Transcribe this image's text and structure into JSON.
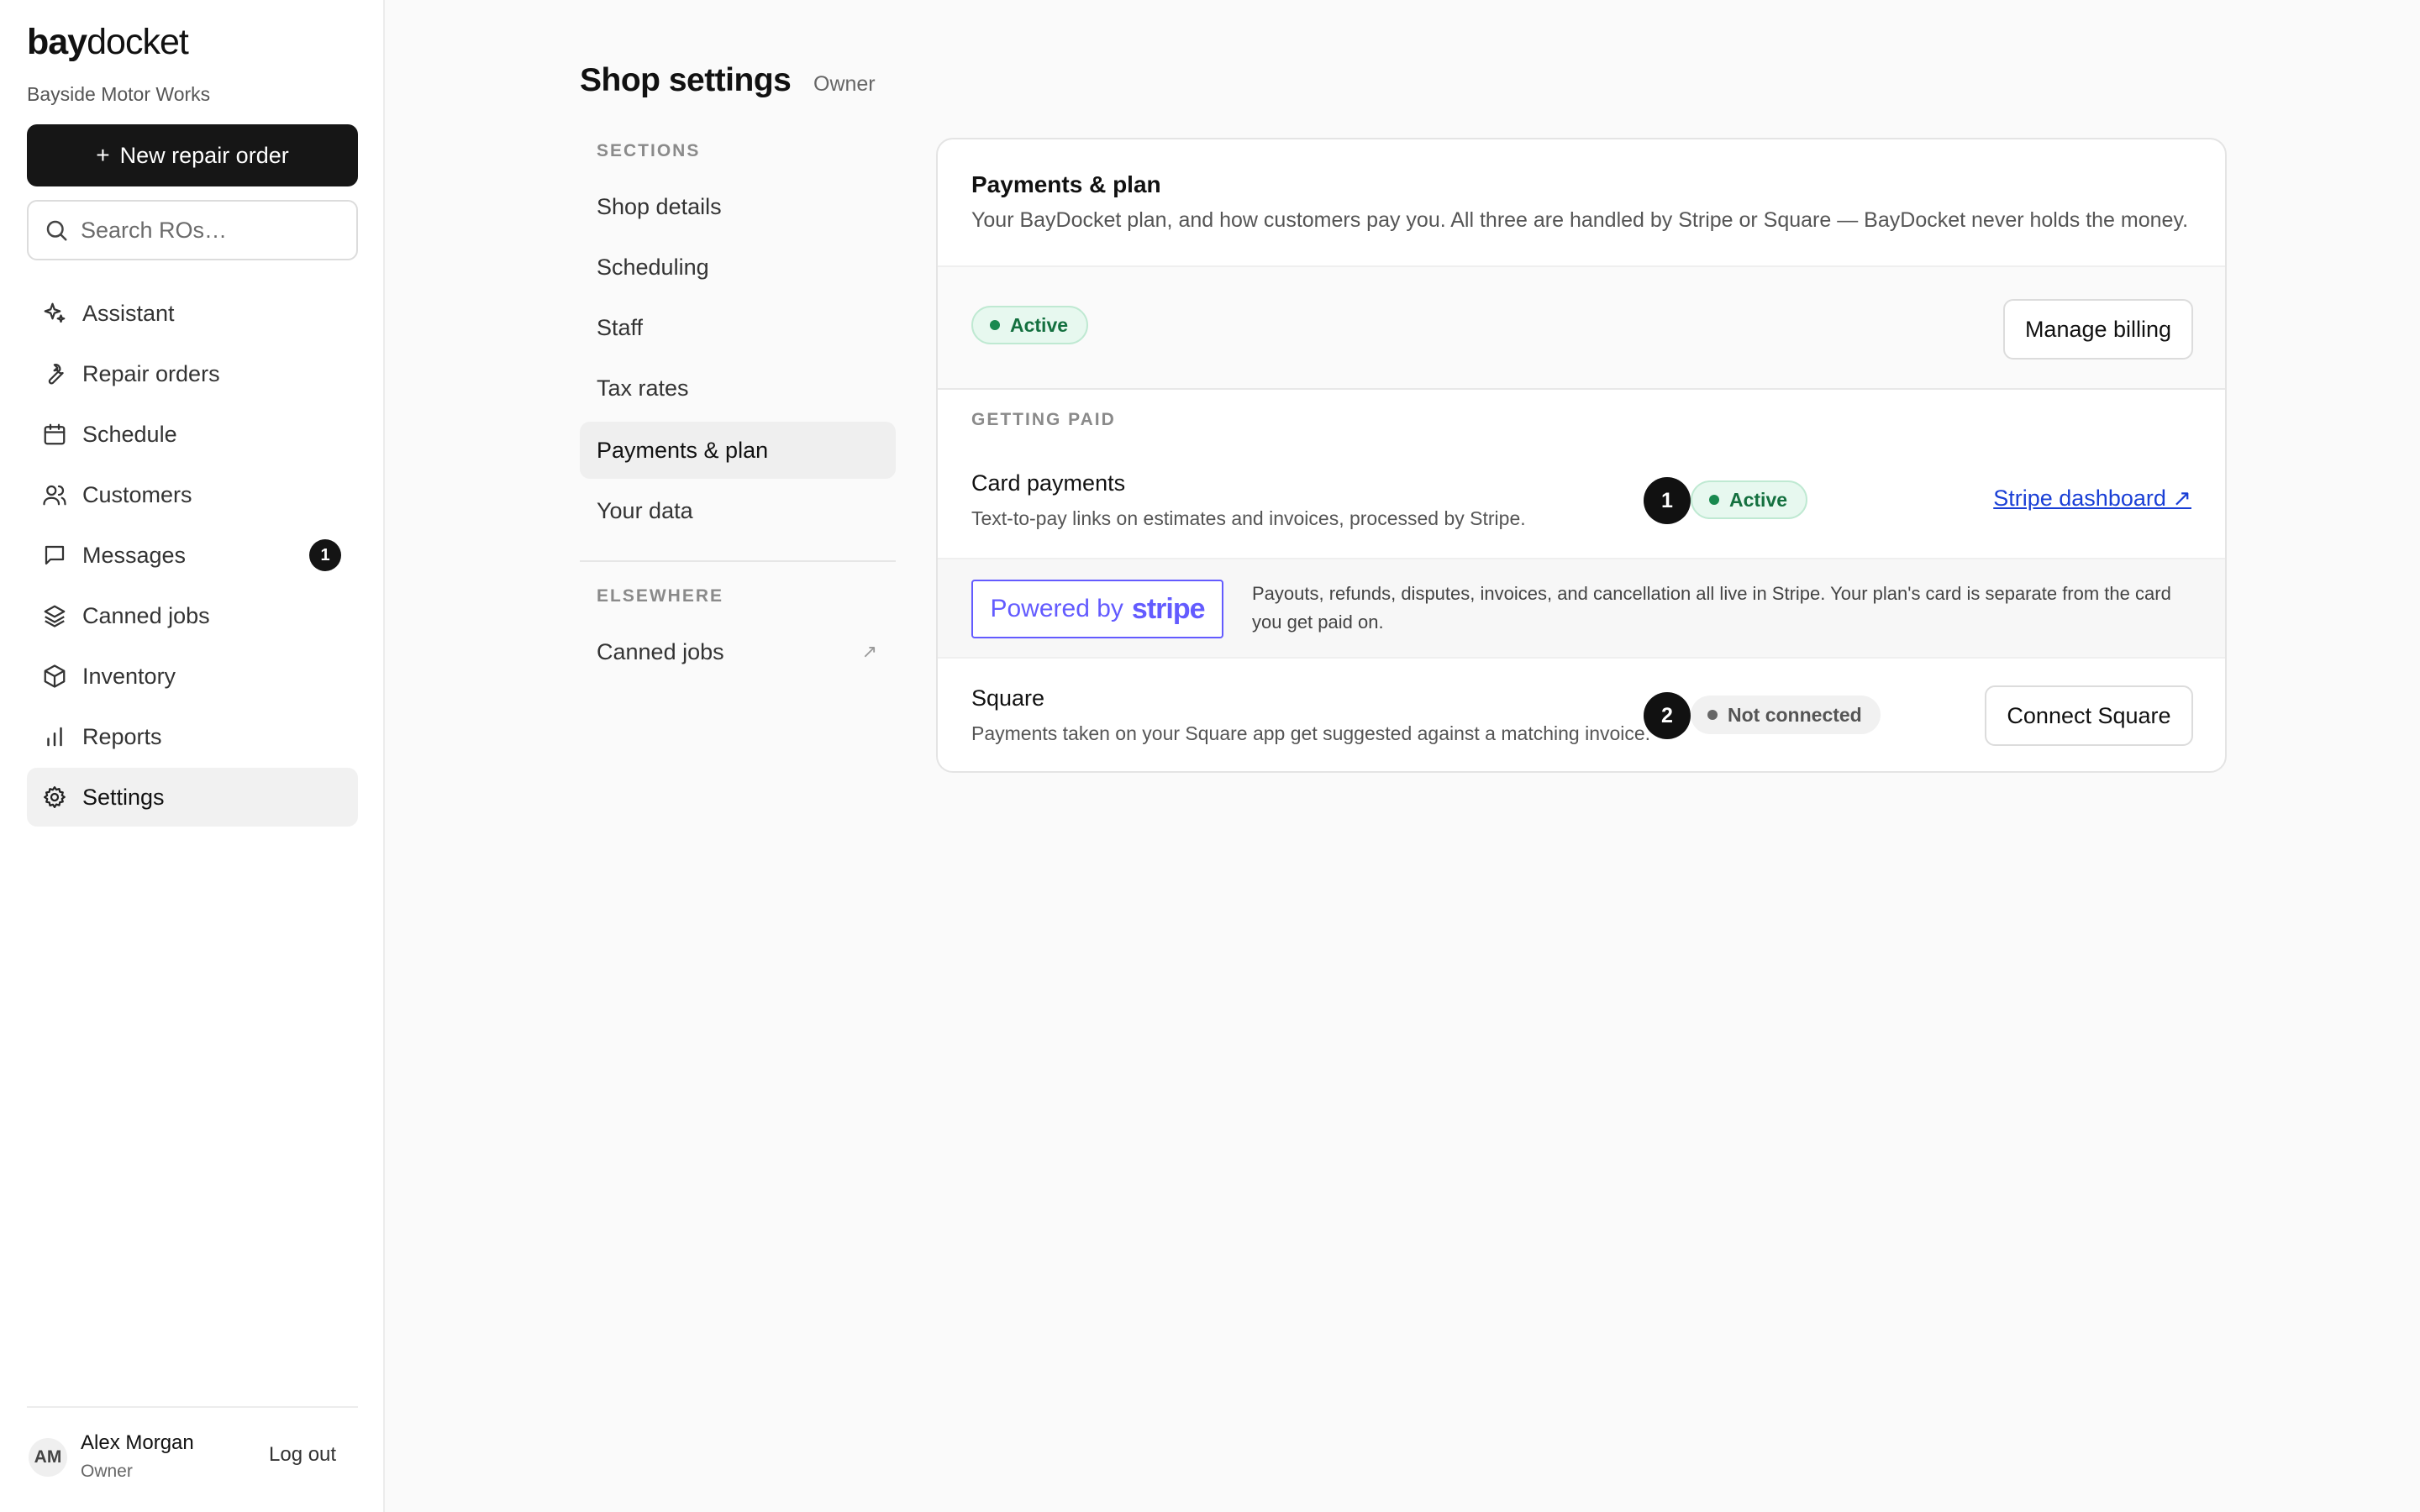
{
  "brand": {
    "logo_bold": "bay",
    "logo_light": "docket",
    "shop_name": "Bayside Motor Works"
  },
  "sidebar": {
    "new_ro_label": "New repair order",
    "new_ro_icon": "plus-icon",
    "search_placeholder": "Search ROs…",
    "items": [
      {
        "label": "Assistant",
        "icon": "sparkle-icon"
      },
      {
        "label": "Repair orders",
        "icon": "wrench-icon"
      },
      {
        "label": "Schedule",
        "icon": "calendar-icon"
      },
      {
        "label": "Customers",
        "icon": "users-icon"
      },
      {
        "label": "Messages",
        "icon": "message-icon",
        "badge": "1"
      },
      {
        "label": "Canned jobs",
        "icon": "layers-icon"
      },
      {
        "label": "Inventory",
        "icon": "box-icon"
      },
      {
        "label": "Reports",
        "icon": "bar-chart-icon"
      },
      {
        "label": "Settings",
        "icon": "gear-icon",
        "active": true
      }
    ]
  },
  "user": {
    "initials": "AM",
    "name": "Alex Morgan",
    "role": "Owner",
    "logout_label": "Log out"
  },
  "header": {
    "title": "Shop settings",
    "role": "Owner"
  },
  "sections_nav": {
    "sections_label": "SECTIONS",
    "items": [
      "Shop details",
      "Scheduling",
      "Staff",
      "Tax rates",
      "Payments & plan",
      "Your data"
    ],
    "active": "Payments & plan",
    "elsewhere_label": "ELSEWHERE",
    "elsewhere_items": [
      {
        "label": "Canned jobs",
        "ext": "↗"
      }
    ]
  },
  "card": {
    "title": "Payments & plan",
    "description": "Your BayDocket plan, and how customers pay you. All three are handled by Stripe or Square — BayDocket never holds the money.",
    "plan_status": "Active",
    "manage_billing_label": "Manage billing",
    "getting_paid_label": "GETTING PAID",
    "card_payments": {
      "marker": "1",
      "title": "Card payments",
      "subtitle": "Text-to-pay links on estimates and invoices, processed by Stripe.",
      "status": "Active",
      "link_label": "Stripe dashboard ↗"
    },
    "stripe": {
      "badge_powered": "Powered by",
      "badge_brand": "stripe",
      "note": "Payouts, refunds, disputes, invoices, and cancellation all live in Stripe. Your plan's card is separate from the card you get paid on."
    },
    "square": {
      "marker": "2",
      "title": "Square",
      "subtitle": "Payments taken on your Square app get suggested against a matching invoice.",
      "status": "Not connected",
      "button_label": "Connect Square"
    }
  },
  "colors": {
    "primary_dark": "#161616",
    "active_green": "#19894f",
    "link_blue": "#1a3fd6",
    "stripe_purple": "#635bff"
  }
}
